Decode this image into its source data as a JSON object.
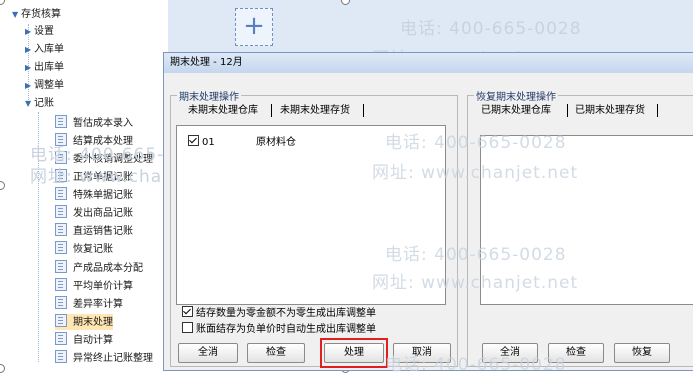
{
  "tree": {
    "root": "存货核算",
    "folders": [
      "设置",
      "入库单",
      "出库单",
      "调整单",
      "记账"
    ],
    "items": [
      "暂估成本录入",
      "结算成本处理",
      "委外核销调整处理",
      "正常单据记账",
      "特殊单据记账",
      "发出商品记账",
      "直运销售记账",
      "恢复记账",
      "产成品成本分配",
      "平均单价计算",
      "差异率计算",
      "期末处理",
      "自动计算",
      "异常终止记账整理"
    ],
    "selected_item": "期末处理"
  },
  "watermark": {
    "phone": "电话: 400-665-0028",
    "site": "网址: www.chanjet.net"
  },
  "dialog": {
    "title": "期末处理 - 12月",
    "left_group": {
      "label": "期末处理操作",
      "tabs": [
        "未期末处理仓库",
        "未期末处理存货"
      ],
      "rows": [
        {
          "checked": true,
          "code": "01",
          "name": "原材料仓"
        }
      ],
      "options": [
        {
          "checked": true,
          "label": "结存数量为零金额不为零生成出库调整单"
        },
        {
          "checked": false,
          "label": "账面结存为负单价时自动生成出库调整单"
        }
      ],
      "buttons": [
        "全消",
        "检查",
        "处理",
        "取消"
      ]
    },
    "right_group": {
      "label": "恢复期末处理操作",
      "tabs": [
        "已期末处理仓库",
        "已期末处理存货"
      ],
      "buttons": [
        "全消",
        "检查",
        "恢复"
      ]
    }
  }
}
